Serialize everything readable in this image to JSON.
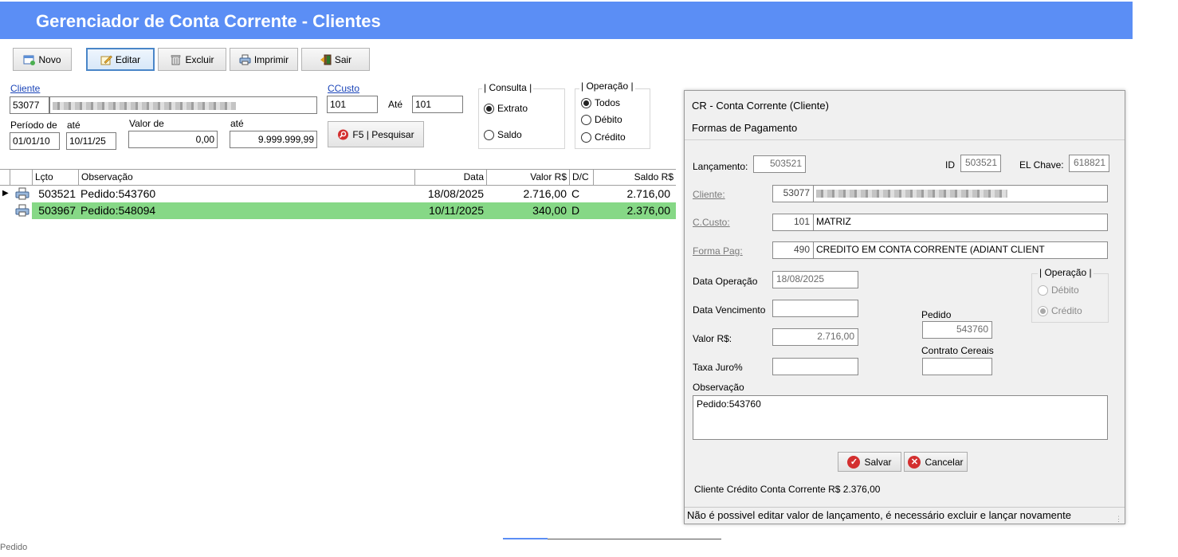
{
  "window": {
    "title": "Gerenciador de Conta Corrente - Clientes"
  },
  "toolbar": {
    "novo": "Novo",
    "editar": "Editar",
    "excluir": "Excluir",
    "imprimir": "Imprimir",
    "sair": "Sair"
  },
  "filters": {
    "cliente_label": "Cliente",
    "cliente_code": "53077",
    "ccusto_label": "CCusto",
    "ccusto_from": "101",
    "ate_label": "Até",
    "ccusto_to": "101",
    "periodo_label": "Período de",
    "periodo_ate_label": "até",
    "valor_label": "Valor de",
    "valor_ate_label": "até",
    "date_from": "01/01/10",
    "date_to": "10/11/25",
    "valor_from": "0,00",
    "valor_to": "9.999.999,99",
    "search_button": "F5 | Pesquisar",
    "consulta": {
      "title": "| Consulta |",
      "options": [
        "Extrato",
        "Saldo"
      ],
      "selected": "Extrato"
    },
    "operacao": {
      "title": "| Operação |",
      "options": [
        "Todos",
        "Débito",
        "Crédito"
      ],
      "selected": "Todos"
    }
  },
  "grid": {
    "columns": [
      "Lçto",
      "Observação",
      "Data",
      "Valor R$",
      "D/C",
      "Saldo R$"
    ],
    "rows": [
      {
        "lcto": "503521",
        "obs": "Pedido:543760",
        "data": "18/08/2025",
        "valor": "2.716,00",
        "dc": "C",
        "saldo": "2.716,00"
      },
      {
        "lcto": "503967",
        "obs": "Pedido:548094",
        "data": "10/11/2025",
        "valor": "340,00",
        "dc": "D",
        "saldo": "2.376,00"
      }
    ]
  },
  "dialog": {
    "title": "CR - Conta Corrente (Cliente)",
    "subtitle": "Formas de Pagamento",
    "lancamento_label": "Lançamento:",
    "lancamento": "503521",
    "id_label": "ID",
    "id": "503521",
    "elchave_label": "EL Chave:",
    "elchave": "618821",
    "cliente_label": "Cliente:",
    "cliente_code": "53077",
    "ccusto_label": "C.Custo:",
    "ccusto_code": "101",
    "ccusto_name": "MATRIZ",
    "formapag_label": "Forma Pag:",
    "formapag_code": "490",
    "formapag_name": "CREDITO EM CONTA CORRENTE (ADIANT CLIENT",
    "data_operacao_label": "Data Operação",
    "data_operacao": "18/08/2025",
    "data_vencimento_label": "Data Vencimento",
    "data_vencimento": "",
    "valor_label": "Valor R$:",
    "valor": "2.716,00",
    "taxa_label": "Taxa Juro%",
    "taxa": "",
    "pedido_label": "Pedido",
    "pedido": "543760",
    "contrato_label": "Contrato Cereais",
    "contrato": "",
    "operacao": {
      "title": "| Operação |",
      "options": [
        "Débito",
        "Crédito"
      ],
      "selected": "Crédito"
    },
    "observacao_label": "Observação",
    "observacao": "Pedido:543760",
    "salvar": "Salvar",
    "cancelar": "Cancelar",
    "saldo_text": "Cliente Crédito Conta Corrente R$ 2.376,00",
    "status_text": "Não é possivel editar valor de lançamento, é necessário excluir e lançar novamente"
  },
  "footer": {
    "left_text": "Pedido"
  },
  "colors": {
    "banner": "#5b8ef5",
    "highlight_row": "#86d886",
    "save_icon": "#d32f2f",
    "cancel_icon": "#d32f2f"
  }
}
